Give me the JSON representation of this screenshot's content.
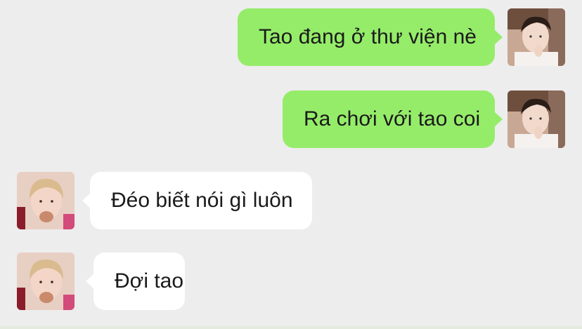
{
  "messages": [
    {
      "side": "right",
      "text": "Tao đang ở thư viện nè",
      "avatar": "me-avatar"
    },
    {
      "side": "right",
      "text": "Ra chơi với tao coi",
      "avatar": "me-avatar"
    },
    {
      "side": "left",
      "text": "Đéo biết nói gì luôn",
      "avatar": "friend-avatar"
    },
    {
      "side": "left",
      "text": "Đợi tao",
      "avatar": "friend-avatar"
    }
  ],
  "colors": {
    "background": "#ededed",
    "outgoing_bubble": "#95ec69",
    "incoming_bubble": "#ffffff"
  }
}
